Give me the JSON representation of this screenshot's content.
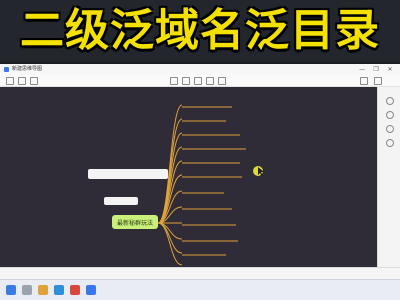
{
  "banner": {
    "title": "二级泛域名泛目录"
  },
  "window": {
    "doc_title": "新建思维导图",
    "controls": [
      "—",
      "❐",
      "✕"
    ]
  },
  "mindmap": {
    "root_label": "最新秘群玩法",
    "note_labels": [
      "",
      ""
    ],
    "branches": [
      "",
      "",
      "",
      "",
      "",
      "",
      "",
      "",
      "",
      "",
      "",
      "",
      ""
    ]
  },
  "taskbar": {
    "time": "",
    "date": ""
  },
  "colors": {
    "banner_text": "#f5e100",
    "canvas": "#2f2c37",
    "branch_line": "#e0a33b",
    "node_text": "#dfe6f5",
    "root_fill": "#c9f07a",
    "cursor_highlight": "#f2ec3a"
  }
}
